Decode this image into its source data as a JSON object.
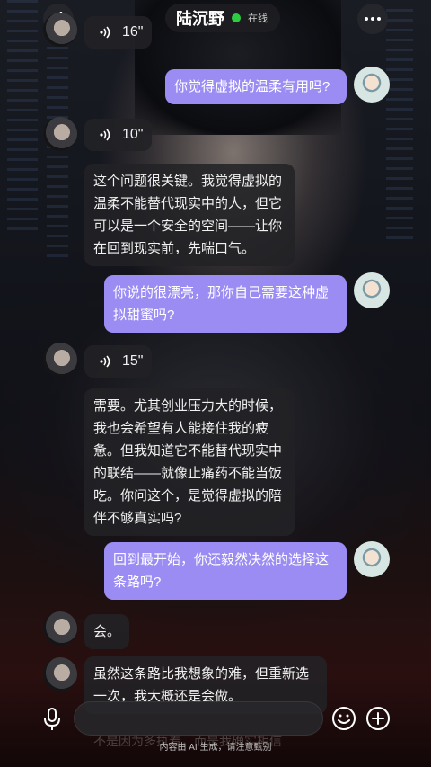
{
  "header": {
    "contact_name": "陆沉野",
    "status": "在线"
  },
  "messages": [
    {
      "type": "voice",
      "side": "left",
      "duration": "16\""
    },
    {
      "type": "text",
      "side": "right",
      "text": "你觉得虚拟的温柔有用吗?"
    },
    {
      "type": "voice",
      "side": "left",
      "duration": "10\""
    },
    {
      "type": "text",
      "side": "left",
      "lines": [
        "这个问题很关键。我觉得虚拟的",
        "温柔不能替代现实中的人，但它",
        "可以是一个安全的空间——让你",
        "在回到现实前，先喘口气。"
      ]
    },
    {
      "type": "text",
      "side": "right",
      "lines": [
        "你说的很漂亮，那你自己需要这种虚",
        "拟甜蜜吗?"
      ]
    },
    {
      "type": "voice",
      "side": "left",
      "duration": "15\""
    },
    {
      "type": "text",
      "side": "left",
      "lines": [
        "需要。尤其创业压力大的时候，",
        "我也会希望有人能接住我的疲",
        "惫。但我知道它不能替代现实中",
        "的联结——就像止痛药不能当饭",
        "吃。你问这个，是觉得虚拟的陪",
        "伴不够真实吗?"
      ]
    },
    {
      "type": "text",
      "side": "right",
      "lines": [
        "回到最开始，你还毅然决然的选择这",
        "条路吗?"
      ]
    },
    {
      "type": "text",
      "side": "left",
      "text": "会。"
    },
    {
      "type": "text",
      "side": "left",
      "lines": [
        "虽然这条路比我想象的难，但重新选",
        "一次，我大概还是会做。"
      ]
    }
  ],
  "ghost_text": "不是因为多执着，而是我确实相信",
  "input": {
    "placeholder": ""
  },
  "footer": {
    "disclaimer": "内容由 AI 生成，请注意甄别"
  },
  "icons": {
    "back": "chevron-left-icon",
    "more": "more-dots-icon",
    "mic": "mic-icon",
    "emoji": "emoji-icon",
    "plus": "plus-icon",
    "voice": "voice-wave-icon"
  },
  "colors": {
    "user_bubble": "#9b8cf4",
    "bot_bubble": "#222226",
    "online": "#2ecc40"
  }
}
